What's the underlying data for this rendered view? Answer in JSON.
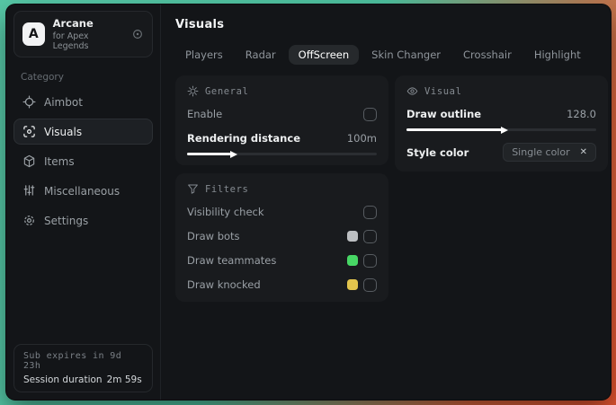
{
  "colors": {
    "desktop_gradient_start": "#57c8a7",
    "desktop_gradient_end": "#e4532f",
    "slider_fill": "#ffffff"
  },
  "sidebar": {
    "app": {
      "logo_letter": "A",
      "name": "Arcane",
      "subtitle": "for Apex Legends"
    },
    "category_label": "Category",
    "items": [
      {
        "label": "Aimbot"
      },
      {
        "label": "Visuals"
      },
      {
        "label": "Items"
      },
      {
        "label": "Miscellaneous"
      },
      {
        "label": "Settings"
      }
    ],
    "footer": {
      "line1": "Sub expires in 9d 23h",
      "line2_label": "Session duration",
      "line2_value": "2m 59s"
    }
  },
  "main": {
    "title": "Visuals",
    "selected_tab": "OffScreen",
    "tabs": [
      {
        "label": "Players"
      },
      {
        "label": "Radar"
      },
      {
        "label": "OffScreen"
      },
      {
        "label": "Skin Changer"
      },
      {
        "label": "Crosshair"
      },
      {
        "label": "Highlight"
      }
    ],
    "general": {
      "header": "General",
      "enable_label": "Enable",
      "rendering": {
        "label": "Rendering distance",
        "value": "100m",
        "fill": "23%"
      }
    },
    "visual": {
      "header": "Visual",
      "outline": {
        "label": "Draw outline",
        "value": "128.0",
        "fill": "50%"
      },
      "style": {
        "label": "Style color",
        "selected_option": "Single color",
        "clear_glyph": "✕"
      }
    },
    "filters": {
      "header": "Filters",
      "rows": [
        {
          "label": "Visibility check",
          "swatch": null
        },
        {
          "label": "Draw bots",
          "swatch": "#bcbfc2"
        },
        {
          "label": "Draw teammates",
          "swatch": "#47d765"
        },
        {
          "label": "Draw knocked",
          "swatch": "#e2c44d"
        }
      ]
    }
  }
}
